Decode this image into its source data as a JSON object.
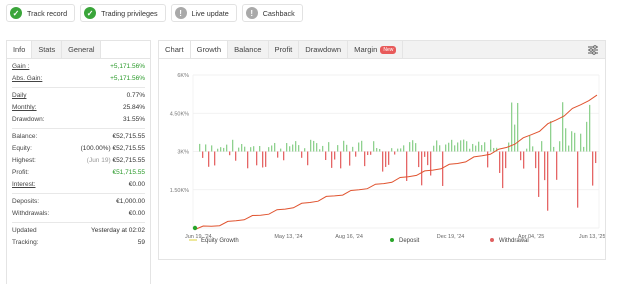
{
  "badges": [
    {
      "label": "Track record",
      "icon": "check-icon",
      "kind": "ok"
    },
    {
      "label": "Trading privileges",
      "icon": "check-icon",
      "kind": "ok"
    },
    {
      "label": "Live update",
      "icon": "info-icon",
      "kind": "info"
    },
    {
      "label": "Cashback",
      "icon": "info-icon",
      "kind": "info"
    }
  ],
  "left_tabs": [
    "Info",
    "Stats",
    "General"
  ],
  "stats": {
    "gain_label": "Gain :",
    "gain_value": "+5,171.56%",
    "abs_gain_label": "Abs. Gain:",
    "abs_gain_value": "+5,171.56%",
    "daily_label": "Daily",
    "daily_value": "0.77%",
    "monthly_label": "Monthly:",
    "monthly_value": "25.84%",
    "drawdown_label": "Drawdown:",
    "drawdown_value": "31.55%",
    "balance_label": "Balance:",
    "balance_value": "€52,715.55",
    "equity_label": "Equity:",
    "equity_sub": "(100.00%)",
    "equity_value": "€52,715.55",
    "highest_label": "Highest:",
    "highest_sub": "(Jun 19)",
    "highest_value": "€52,715.55",
    "profit_label": "Profit:",
    "profit_value": "€51,715.55",
    "interest_label": "Interest:",
    "interest_value": "€0.00",
    "deposits_label": "Deposits:",
    "deposits_value": "€1,000.00",
    "withdrawals_label": "Withdrawals:",
    "withdrawals_value": "€0.00",
    "updated_label": "Updated",
    "updated_value": "Yesterday at 02:02",
    "tracking_label": "Tracking:",
    "tracking_value": "59"
  },
  "chart_tabs": [
    "Chart",
    "Growth",
    "Balance",
    "Profit",
    "Drawdown",
    "Margin"
  ],
  "new_badge": "New",
  "colors": {
    "equity": "#e8e07a",
    "growth": "#e0532f",
    "deposit": "#2aa52a",
    "withdrawal": "#e06060",
    "bar_green": "#8fd18f",
    "bar_red": "#e56666"
  },
  "chart_data": {
    "type": "line",
    "x_ticks": [
      "Jun 19, '24",
      "May 13, '24",
      "Aug 16, '24",
      "Dec 19, '24",
      "Apr 04, '25",
      "Jun 13, '25"
    ],
    "y_ticks": [
      "6K%",
      "4.50K%",
      "3K%",
      "1.50K%",
      "0"
    ],
    "ylim": [
      0,
      6000
    ],
    "legend": [
      "Equity Growth",
      "Deposit",
      "Withdrawal"
    ],
    "series": [
      {
        "name": "Growth",
        "values": [
          0,
          40,
          90,
          150,
          220,
          300,
          380,
          450,
          520,
          600,
          680,
          760,
          850,
          930,
          1020,
          1110,
          1200,
          1280,
          1350,
          1430,
          1520,
          1600,
          1680,
          1760,
          1850,
          1940,
          2030,
          2120,
          2200,
          2290,
          2380,
          2460,
          2550,
          2650,
          2750,
          2850,
          2950,
          3050,
          3180,
          3350,
          3500,
          3680,
          3850,
          4050,
          4250,
          4450,
          4650,
          4850,
          5050,
          5171.56
        ]
      }
    ]
  }
}
